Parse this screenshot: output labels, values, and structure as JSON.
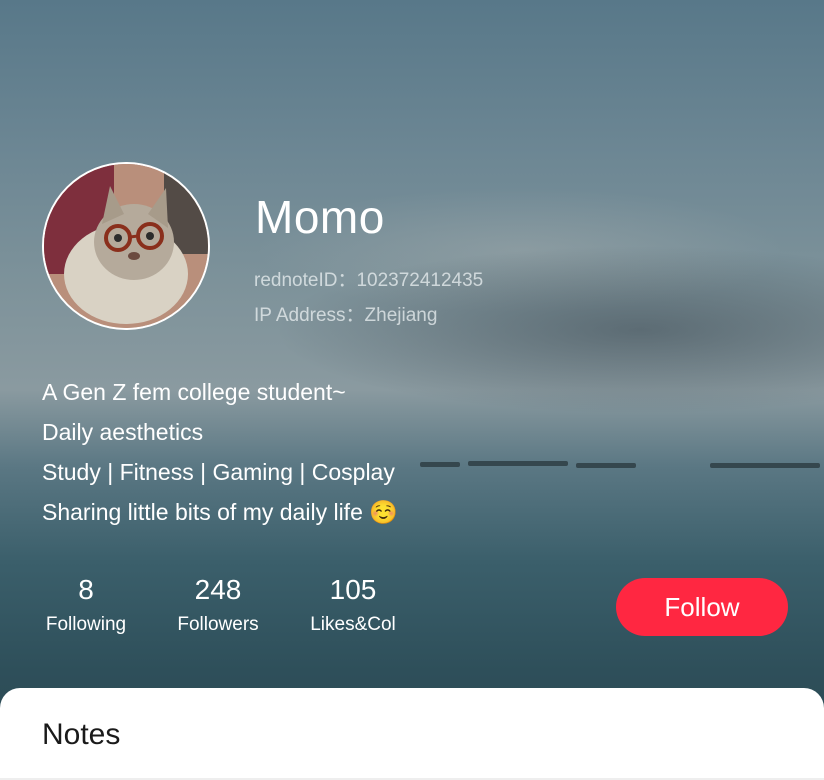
{
  "profile": {
    "name": "Momo",
    "rednote_id": "rednoteID：102372412435",
    "ip_address": "IP Address：Zhejiang",
    "avatar_icon": "cat-with-glasses-avatar"
  },
  "bio": {
    "lines": [
      "A Gen Z fem college student~",
      "Daily aesthetics",
      "Study | Fitness | Gaming | Cosplay",
      "Sharing little bits of my daily life ☺️"
    ]
  },
  "stats": [
    {
      "value": "8",
      "label": "Following"
    },
    {
      "value": "248",
      "label": "Followers"
    },
    {
      "value": "105",
      "label": "Likes&Col"
    }
  ],
  "actions": {
    "follow_label": "Follow",
    "follow_color": "#ff2741"
  },
  "tabs": {
    "notes_label": "Notes"
  }
}
